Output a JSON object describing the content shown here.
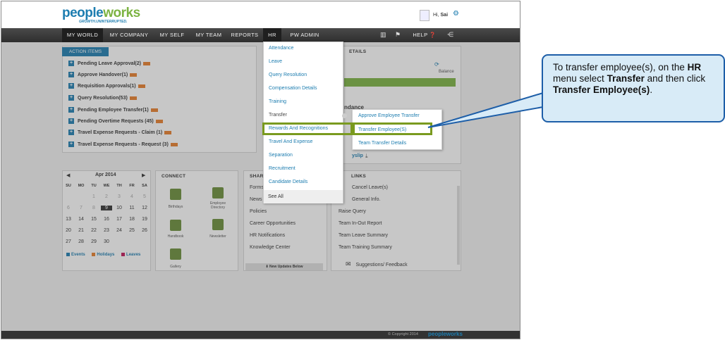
{
  "header": {
    "logo_main": "peopleworks",
    "tagline": "GROWTH.UNINTERRUPTED.",
    "greeting_prefix": "Hi,",
    "user_name": "Sai"
  },
  "nav": {
    "items": [
      "MY WORLD",
      "MY COMPANY",
      "MY SELF",
      "MY TEAM",
      "REPORTS",
      "HR",
      "PW ADMIN"
    ],
    "help_label": "HELP"
  },
  "action_items": {
    "tab_label": "ACTION ITEMS",
    "rows": [
      "Pending Leave Approval(2)",
      "Approve Handover(1)",
      "Requisition Approvals(1)",
      "Query Resolution(53)",
      "Pending Employee Transfer(1)",
      "Pending Overtime Requests (45)",
      "Travel Expense Requests - Claim (1)",
      "Travel Expense Requests - Request (3)"
    ]
  },
  "hr_menu": {
    "items": [
      "Attendance",
      "Leave",
      "Query Resolution",
      "Compensation Details",
      "Training",
      "Transfer",
      "Rewards And Recognitions",
      "Travel And Expense",
      "Separation",
      "Recruitment",
      "Candidate Details"
    ],
    "see_all": "See All"
  },
  "transfer_submenu": {
    "items": [
      "Approve Employee Transfer",
      "Transfer Employee(S)",
      "Team Transfer Details"
    ]
  },
  "right_panel": {
    "title": "ETAILS",
    "balance_label": "Balance",
    "attendance_label": "ndance",
    "payslip_label": "yslip"
  },
  "calendar": {
    "month_label": "Apr 2014",
    "weekdays": [
      "SU",
      "MO",
      "TU",
      "WE",
      "TH",
      "FR",
      "SA"
    ],
    "weeks": [
      [
        "",
        "",
        "1",
        "2",
        "3",
        "4",
        "5"
      ],
      [
        "6",
        "7",
        "8",
        "9",
        "10",
        "11",
        "12"
      ],
      [
        "13",
        "14",
        "15",
        "16",
        "17",
        "18",
        "19"
      ],
      [
        "20",
        "21",
        "22",
        "23",
        "24",
        "25",
        "26"
      ],
      [
        "27",
        "28",
        "29",
        "30",
        "",
        "",
        ""
      ]
    ],
    "legend": [
      "Events",
      "Holidays",
      "Leaves"
    ]
  },
  "connect": {
    "title": "CONNECT",
    "items": [
      "Birthdays",
      "Employee Directory",
      "Handbook",
      "Newsletter",
      "Gallery"
    ]
  },
  "share": {
    "title": "SHAR",
    "items": [
      "Forms",
      "News",
      "Policies",
      "Career Opportunities",
      "HR Notifications",
      "Knowledge Center"
    ],
    "footer": "New Updates Below"
  },
  "quick_links": {
    "title": "LINKS",
    "items": [
      "Cancel Leave(s)",
      "General Info.",
      "Raise Query",
      "Team In-Out Report",
      "Team Leave Summary",
      "Team Training Summary"
    ],
    "feedback": "Suggestions/ Feedback"
  },
  "footer": {
    "copyright": "© Copyright 2014",
    "logo": "peopleworks"
  },
  "callout": {
    "text_1": "To transfer employee(s), on the",
    "bold_hr": "HR",
    "text_2": "menu select",
    "bold_transfer": "Transfer",
    "text_3": "and then click",
    "bold_transfer_emp": "Transfer Employee(s)",
    "text_4": "."
  },
  "colors": {
    "brand_blue": "#1d7db0",
    "highlight_green": "#7a9a1f",
    "callout_bg": "#d8ebf7",
    "callout_border": "#1d5ea8"
  }
}
